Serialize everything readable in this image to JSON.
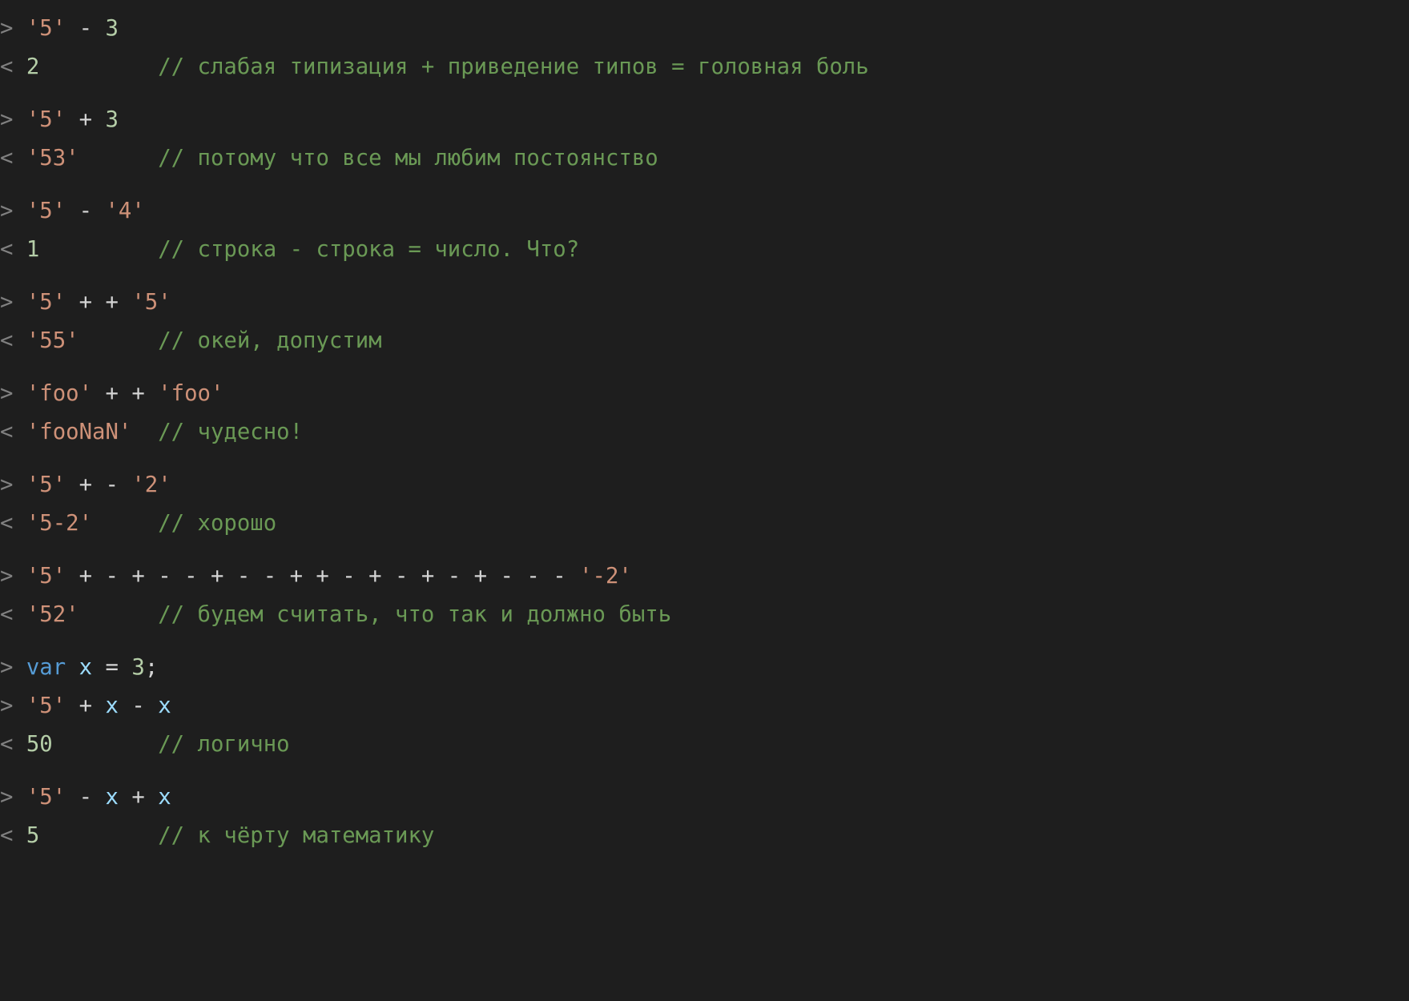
{
  "blocks": [
    {
      "lines": [
        {
          "prompt": ">",
          "segments": [
            {
              "t": " ",
              "cls": "op"
            },
            {
              "t": "'5'",
              "cls": "str"
            },
            {
              "t": " - ",
              "cls": "op"
            },
            {
              "t": "3",
              "cls": "num"
            }
          ]
        },
        {
          "prompt": "<",
          "segments": [
            {
              "t": " ",
              "cls": "op"
            },
            {
              "t": "2",
              "cls": "num"
            },
            {
              "t": "         ",
              "cls": "op"
            },
            {
              "t": "// слабая типизация + приведение типов = головная боль",
              "cls": "comment"
            }
          ]
        }
      ]
    },
    {
      "lines": [
        {
          "prompt": ">",
          "segments": [
            {
              "t": " ",
              "cls": "op"
            },
            {
              "t": "'5'",
              "cls": "str"
            },
            {
              "t": " + ",
              "cls": "op"
            },
            {
              "t": "3",
              "cls": "num"
            }
          ]
        },
        {
          "prompt": "<",
          "segments": [
            {
              "t": " ",
              "cls": "op"
            },
            {
              "t": "'53'",
              "cls": "str"
            },
            {
              "t": "      ",
              "cls": "op"
            },
            {
              "t": "// потому что все мы любим постоянство",
              "cls": "comment"
            }
          ]
        }
      ]
    },
    {
      "lines": [
        {
          "prompt": ">",
          "segments": [
            {
              "t": " ",
              "cls": "op"
            },
            {
              "t": "'5'",
              "cls": "str"
            },
            {
              "t": " - ",
              "cls": "op"
            },
            {
              "t": "'4'",
              "cls": "str"
            }
          ]
        },
        {
          "prompt": "<",
          "segments": [
            {
              "t": " ",
              "cls": "op"
            },
            {
              "t": "1",
              "cls": "num"
            },
            {
              "t": "         ",
              "cls": "op"
            },
            {
              "t": "// строка - строка = число. Что?",
              "cls": "comment"
            }
          ]
        }
      ]
    },
    {
      "lines": [
        {
          "prompt": ">",
          "segments": [
            {
              "t": " ",
              "cls": "op"
            },
            {
              "t": "'5'",
              "cls": "str"
            },
            {
              "t": " + + ",
              "cls": "op"
            },
            {
              "t": "'5'",
              "cls": "str"
            }
          ]
        },
        {
          "prompt": "<",
          "segments": [
            {
              "t": " ",
              "cls": "op"
            },
            {
              "t": "'55'",
              "cls": "str"
            },
            {
              "t": "      ",
              "cls": "op"
            },
            {
              "t": "// окей, допустим",
              "cls": "comment"
            }
          ]
        }
      ]
    },
    {
      "lines": [
        {
          "prompt": ">",
          "segments": [
            {
              "t": " ",
              "cls": "op"
            },
            {
              "t": "'foo'",
              "cls": "str"
            },
            {
              "t": " + + ",
              "cls": "op"
            },
            {
              "t": "'foo'",
              "cls": "str"
            }
          ]
        },
        {
          "prompt": "<",
          "segments": [
            {
              "t": " ",
              "cls": "op"
            },
            {
              "t": "'fooNaN'",
              "cls": "str"
            },
            {
              "t": "  ",
              "cls": "op"
            },
            {
              "t": "// чудесно!",
              "cls": "comment"
            }
          ]
        }
      ]
    },
    {
      "lines": [
        {
          "prompt": ">",
          "segments": [
            {
              "t": " ",
              "cls": "op"
            },
            {
              "t": "'5'",
              "cls": "str"
            },
            {
              "t": " + - ",
              "cls": "op"
            },
            {
              "t": "'2'",
              "cls": "str"
            }
          ]
        },
        {
          "prompt": "<",
          "segments": [
            {
              "t": " ",
              "cls": "op"
            },
            {
              "t": "'5-2'",
              "cls": "str"
            },
            {
              "t": "     ",
              "cls": "op"
            },
            {
              "t": "// хорошо",
              "cls": "comment"
            }
          ]
        }
      ]
    },
    {
      "lines": [
        {
          "prompt": ">",
          "segments": [
            {
              "t": " ",
              "cls": "op"
            },
            {
              "t": "'5'",
              "cls": "str"
            },
            {
              "t": " + - + - - + - - + + - + - + - + - - - ",
              "cls": "op"
            },
            {
              "t": "'-2'",
              "cls": "str"
            }
          ]
        },
        {
          "prompt": "<",
          "segments": [
            {
              "t": " ",
              "cls": "op"
            },
            {
              "t": "'52'",
              "cls": "str"
            },
            {
              "t": "      ",
              "cls": "op"
            },
            {
              "t": "// будем считать, что так и должно быть",
              "cls": "comment"
            }
          ]
        }
      ]
    },
    {
      "lines": [
        {
          "prompt": ">",
          "segments": [
            {
              "t": " ",
              "cls": "op"
            },
            {
              "t": "var",
              "cls": "kw"
            },
            {
              "t": " ",
              "cls": "op"
            },
            {
              "t": "x",
              "cls": "ident"
            },
            {
              "t": " = ",
              "cls": "op"
            },
            {
              "t": "3",
              "cls": "num"
            },
            {
              "t": ";",
              "cls": "op"
            }
          ]
        },
        {
          "prompt": ">",
          "segments": [
            {
              "t": " ",
              "cls": "op"
            },
            {
              "t": "'5'",
              "cls": "str"
            },
            {
              "t": " + ",
              "cls": "op"
            },
            {
              "t": "x",
              "cls": "ident"
            },
            {
              "t": " - ",
              "cls": "op"
            },
            {
              "t": "x",
              "cls": "ident"
            }
          ]
        },
        {
          "prompt": "<",
          "segments": [
            {
              "t": " ",
              "cls": "op"
            },
            {
              "t": "50",
              "cls": "num"
            },
            {
              "t": "        ",
              "cls": "op"
            },
            {
              "t": "// логично",
              "cls": "comment"
            }
          ]
        }
      ]
    },
    {
      "lines": [
        {
          "prompt": ">",
          "segments": [
            {
              "t": " ",
              "cls": "op"
            },
            {
              "t": "'5'",
              "cls": "str"
            },
            {
              "t": " - ",
              "cls": "op"
            },
            {
              "t": "x",
              "cls": "ident"
            },
            {
              "t": " + ",
              "cls": "op"
            },
            {
              "t": "x",
              "cls": "ident"
            }
          ]
        },
        {
          "prompt": "<",
          "segments": [
            {
              "t": " ",
              "cls": "op"
            },
            {
              "t": "5",
              "cls": "num"
            },
            {
              "t": "         ",
              "cls": "op"
            },
            {
              "t": "// к чёрту математику",
              "cls": "comment"
            }
          ]
        }
      ]
    }
  ]
}
